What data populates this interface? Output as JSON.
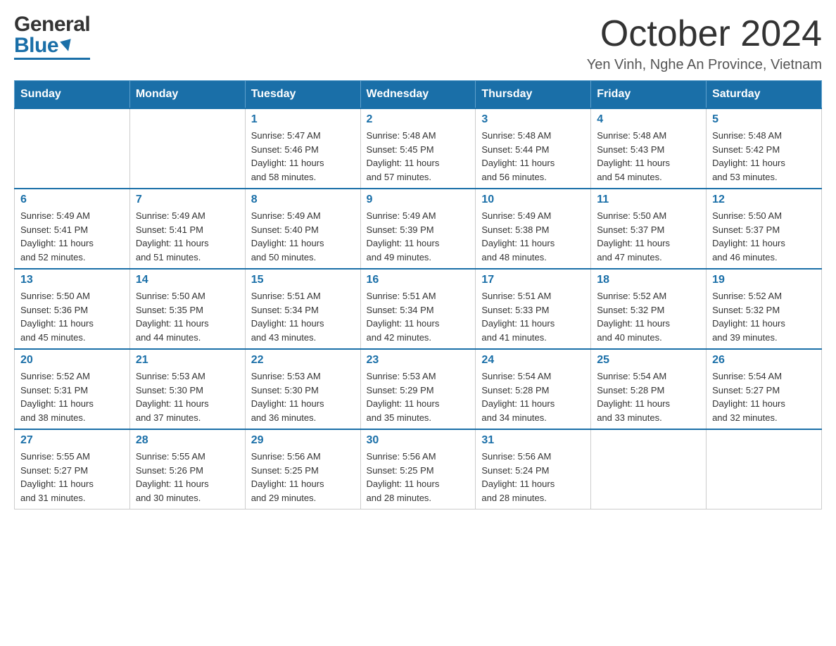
{
  "header": {
    "title": "October 2024",
    "location": "Yen Vinh, Nghe An Province, Vietnam",
    "logo_general": "General",
    "logo_blue": "Blue"
  },
  "days_of_week": [
    "Sunday",
    "Monday",
    "Tuesday",
    "Wednesday",
    "Thursday",
    "Friday",
    "Saturday"
  ],
  "weeks": [
    [
      {
        "day": "",
        "info": ""
      },
      {
        "day": "",
        "info": ""
      },
      {
        "day": "1",
        "info": "Sunrise: 5:47 AM\nSunset: 5:46 PM\nDaylight: 11 hours\nand 58 minutes."
      },
      {
        "day": "2",
        "info": "Sunrise: 5:48 AM\nSunset: 5:45 PM\nDaylight: 11 hours\nand 57 minutes."
      },
      {
        "day": "3",
        "info": "Sunrise: 5:48 AM\nSunset: 5:44 PM\nDaylight: 11 hours\nand 56 minutes."
      },
      {
        "day": "4",
        "info": "Sunrise: 5:48 AM\nSunset: 5:43 PM\nDaylight: 11 hours\nand 54 minutes."
      },
      {
        "day": "5",
        "info": "Sunrise: 5:48 AM\nSunset: 5:42 PM\nDaylight: 11 hours\nand 53 minutes."
      }
    ],
    [
      {
        "day": "6",
        "info": "Sunrise: 5:49 AM\nSunset: 5:41 PM\nDaylight: 11 hours\nand 52 minutes."
      },
      {
        "day": "7",
        "info": "Sunrise: 5:49 AM\nSunset: 5:41 PM\nDaylight: 11 hours\nand 51 minutes."
      },
      {
        "day": "8",
        "info": "Sunrise: 5:49 AM\nSunset: 5:40 PM\nDaylight: 11 hours\nand 50 minutes."
      },
      {
        "day": "9",
        "info": "Sunrise: 5:49 AM\nSunset: 5:39 PM\nDaylight: 11 hours\nand 49 minutes."
      },
      {
        "day": "10",
        "info": "Sunrise: 5:49 AM\nSunset: 5:38 PM\nDaylight: 11 hours\nand 48 minutes."
      },
      {
        "day": "11",
        "info": "Sunrise: 5:50 AM\nSunset: 5:37 PM\nDaylight: 11 hours\nand 47 minutes."
      },
      {
        "day": "12",
        "info": "Sunrise: 5:50 AM\nSunset: 5:37 PM\nDaylight: 11 hours\nand 46 minutes."
      }
    ],
    [
      {
        "day": "13",
        "info": "Sunrise: 5:50 AM\nSunset: 5:36 PM\nDaylight: 11 hours\nand 45 minutes."
      },
      {
        "day": "14",
        "info": "Sunrise: 5:50 AM\nSunset: 5:35 PM\nDaylight: 11 hours\nand 44 minutes."
      },
      {
        "day": "15",
        "info": "Sunrise: 5:51 AM\nSunset: 5:34 PM\nDaylight: 11 hours\nand 43 minutes."
      },
      {
        "day": "16",
        "info": "Sunrise: 5:51 AM\nSunset: 5:34 PM\nDaylight: 11 hours\nand 42 minutes."
      },
      {
        "day": "17",
        "info": "Sunrise: 5:51 AM\nSunset: 5:33 PM\nDaylight: 11 hours\nand 41 minutes."
      },
      {
        "day": "18",
        "info": "Sunrise: 5:52 AM\nSunset: 5:32 PM\nDaylight: 11 hours\nand 40 minutes."
      },
      {
        "day": "19",
        "info": "Sunrise: 5:52 AM\nSunset: 5:32 PM\nDaylight: 11 hours\nand 39 minutes."
      }
    ],
    [
      {
        "day": "20",
        "info": "Sunrise: 5:52 AM\nSunset: 5:31 PM\nDaylight: 11 hours\nand 38 minutes."
      },
      {
        "day": "21",
        "info": "Sunrise: 5:53 AM\nSunset: 5:30 PM\nDaylight: 11 hours\nand 37 minutes."
      },
      {
        "day": "22",
        "info": "Sunrise: 5:53 AM\nSunset: 5:30 PM\nDaylight: 11 hours\nand 36 minutes."
      },
      {
        "day": "23",
        "info": "Sunrise: 5:53 AM\nSunset: 5:29 PM\nDaylight: 11 hours\nand 35 minutes."
      },
      {
        "day": "24",
        "info": "Sunrise: 5:54 AM\nSunset: 5:28 PM\nDaylight: 11 hours\nand 34 minutes."
      },
      {
        "day": "25",
        "info": "Sunrise: 5:54 AM\nSunset: 5:28 PM\nDaylight: 11 hours\nand 33 minutes."
      },
      {
        "day": "26",
        "info": "Sunrise: 5:54 AM\nSunset: 5:27 PM\nDaylight: 11 hours\nand 32 minutes."
      }
    ],
    [
      {
        "day": "27",
        "info": "Sunrise: 5:55 AM\nSunset: 5:27 PM\nDaylight: 11 hours\nand 31 minutes."
      },
      {
        "day": "28",
        "info": "Sunrise: 5:55 AM\nSunset: 5:26 PM\nDaylight: 11 hours\nand 30 minutes."
      },
      {
        "day": "29",
        "info": "Sunrise: 5:56 AM\nSunset: 5:25 PM\nDaylight: 11 hours\nand 29 minutes."
      },
      {
        "day": "30",
        "info": "Sunrise: 5:56 AM\nSunset: 5:25 PM\nDaylight: 11 hours\nand 28 minutes."
      },
      {
        "day": "31",
        "info": "Sunrise: 5:56 AM\nSunset: 5:24 PM\nDaylight: 11 hours\nand 28 minutes."
      },
      {
        "day": "",
        "info": ""
      },
      {
        "day": "",
        "info": ""
      }
    ]
  ]
}
